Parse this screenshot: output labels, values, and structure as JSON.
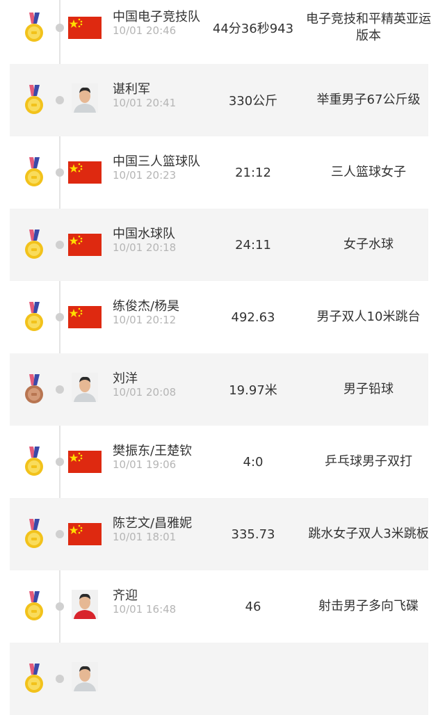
{
  "colors": {
    "gold": "#f2c21b",
    "bronze": "#b87551",
    "flag_red": "#de2910",
    "flag_star": "#ffde00"
  },
  "medals": [
    {
      "medal": "gold",
      "avatar": "flag-icon",
      "name": "中国电子竞技队",
      "time": "10/01 20:46",
      "result": "44分36秒943",
      "event": "电子竞技和平精英亚运版本"
    },
    {
      "medal": "gold",
      "avatar": "athlete-photo",
      "name": "谌利军",
      "time": "10/01 20:41",
      "result": "330公斤",
      "event": "举重男子67公斤级"
    },
    {
      "medal": "gold",
      "avatar": "flag-icon",
      "name": "中国三人篮球队",
      "time": "10/01 20:23",
      "result": "21:12",
      "event": "三人篮球女子"
    },
    {
      "medal": "gold",
      "avatar": "flag-icon",
      "name": "中国水球队",
      "time": "10/01 20:18",
      "result": "24:11",
      "event": "女子水球"
    },
    {
      "medal": "gold",
      "avatar": "flag-icon",
      "name": "练俊杰/杨昊",
      "time": "10/01 20:12",
      "result": "492.63",
      "event": "男子双人10米跳台"
    },
    {
      "medal": "bronze",
      "avatar": "athlete-photo",
      "name": "刘洋",
      "time": "10/01 20:08",
      "result": "19.97米",
      "event": "男子铅球"
    },
    {
      "medal": "gold",
      "avatar": "flag-icon",
      "name": "樊振东/王楚钦",
      "time": "10/01 19:06",
      "result": "4:0",
      "event": "乒乓球男子双打"
    },
    {
      "medal": "gold",
      "avatar": "flag-icon",
      "name": "陈艺文/昌雅妮",
      "time": "10/01 18:01",
      "result": "335.73",
      "event": "跳水女子双人3米跳板"
    },
    {
      "medal": "gold",
      "avatar": "athlete-photo-red",
      "name": "齐迎",
      "time": "10/01 16:48",
      "result": "46",
      "event": "射击男子多向飞碟"
    },
    {
      "medal": "gold",
      "avatar": "athlete-photo",
      "name": "",
      "time": "",
      "result": "",
      "event": ""
    }
  ]
}
